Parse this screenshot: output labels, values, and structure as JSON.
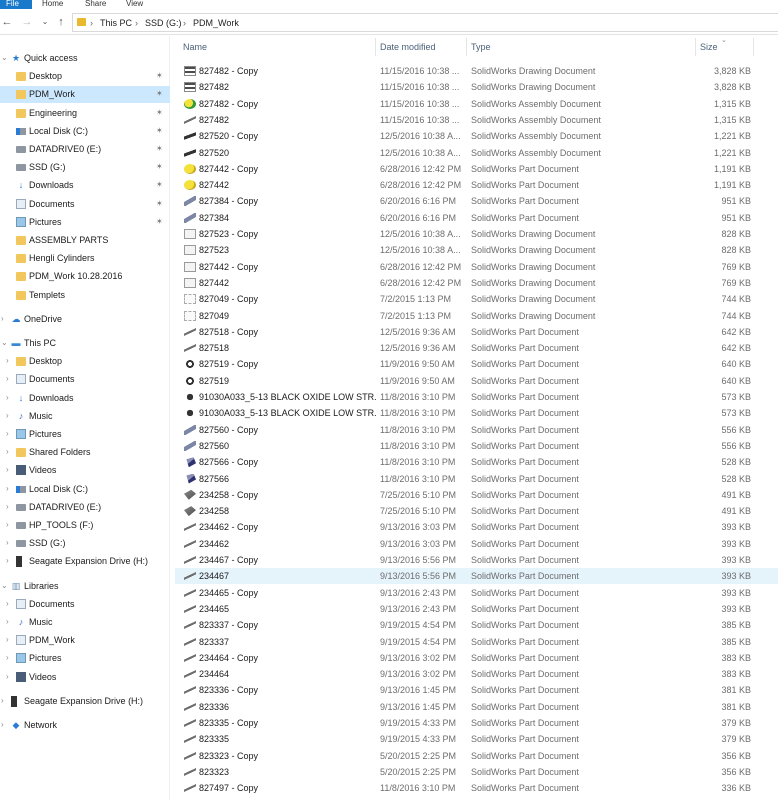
{
  "ribbon": {
    "tabs": [
      "File",
      "Home",
      "Share",
      "View"
    ]
  },
  "address": {
    "crumbs": [
      "This PC",
      "SSD (G:)",
      "PDM_Work"
    ]
  },
  "nav": {
    "items": [
      {
        "label": "Quick access",
        "icon": "star-icon",
        "level": 0,
        "exp": "v",
        "pin": false
      },
      {
        "label": "Desktop",
        "icon": "folder-icon",
        "level": 1,
        "pin": true
      },
      {
        "label": "PDM_Work",
        "icon": "folder-icon",
        "level": 1,
        "pin": true,
        "selected": true
      },
      {
        "label": "Engineering",
        "icon": "folder-icon",
        "level": 1,
        "pin": true
      },
      {
        "label": "Local Disk (C:)",
        "icon": "windows-drive-icon",
        "level": 1,
        "pin": true
      },
      {
        "label": "DATADRIVE0 (E:)",
        "icon": "drive-icon",
        "level": 1,
        "pin": true
      },
      {
        "label": "SSD (G:)",
        "icon": "drive-icon",
        "level": 1,
        "pin": true
      },
      {
        "label": "Downloads",
        "icon": "download-icon",
        "level": 1,
        "pin": true
      },
      {
        "label": "Documents",
        "icon": "document-icon",
        "level": 1,
        "pin": true
      },
      {
        "label": "Pictures",
        "icon": "picture-icon",
        "level": 1,
        "pin": true
      },
      {
        "label": "ASSEMBLY PARTS",
        "icon": "folder-icon",
        "level": 1,
        "pin": false
      },
      {
        "label": "Hengli Cylinders",
        "icon": "folder-icon",
        "level": 1,
        "pin": false
      },
      {
        "label": "PDM_Work 10.28.2016",
        "icon": "folder-icon",
        "level": 1,
        "pin": false
      },
      {
        "label": "Templets",
        "icon": "folder-icon",
        "level": 1,
        "pin": false
      },
      {
        "label": "OneDrive",
        "icon": "cloud-icon",
        "level": 0,
        "exp": ">",
        "gap": true
      },
      {
        "label": "This PC",
        "icon": "computer-icon",
        "level": 0,
        "exp": "v",
        "gap": true
      },
      {
        "label": "Desktop",
        "icon": "folder-icon",
        "level": 1,
        "exp": ">"
      },
      {
        "label": "Documents",
        "icon": "document-icon",
        "level": 1,
        "exp": ">"
      },
      {
        "label": "Downloads",
        "icon": "download-icon",
        "level": 1,
        "exp": ">"
      },
      {
        "label": "Music",
        "icon": "music-icon",
        "level": 1,
        "exp": ">"
      },
      {
        "label": "Pictures",
        "icon": "picture-icon",
        "level": 1,
        "exp": ">"
      },
      {
        "label": "Shared Folders",
        "icon": "folder-icon",
        "level": 1,
        "exp": ">"
      },
      {
        "label": "Videos",
        "icon": "video-icon",
        "level": 1,
        "exp": ">"
      },
      {
        "label": "Local Disk (C:)",
        "icon": "windows-drive-icon",
        "level": 1,
        "exp": ">"
      },
      {
        "label": "DATADRIVE0 (E:)",
        "icon": "drive-icon",
        "level": 1,
        "exp": ">"
      },
      {
        "label": "HP_TOOLS (F:)",
        "icon": "drive-icon",
        "level": 1,
        "exp": ">"
      },
      {
        "label": "SSD (G:)",
        "icon": "drive-icon",
        "level": 1,
        "exp": ">"
      },
      {
        "label": "Seagate Expansion Drive (H:)",
        "icon": "external-drive-icon",
        "level": 1,
        "exp": ">"
      },
      {
        "label": "Libraries",
        "icon": "library-icon",
        "level": 0,
        "exp": "v",
        "gap": true
      },
      {
        "label": "Documents",
        "icon": "document-icon",
        "level": 1,
        "exp": ">"
      },
      {
        "label": "Music",
        "icon": "music-icon",
        "level": 1,
        "exp": ">"
      },
      {
        "label": "PDM_Work",
        "icon": "document-icon",
        "level": 1,
        "exp": ">"
      },
      {
        "label": "Pictures",
        "icon": "picture-icon",
        "level": 1,
        "exp": ">"
      },
      {
        "label": "Videos",
        "icon": "video-icon",
        "level": 1,
        "exp": ">"
      },
      {
        "label": "Seagate Expansion Drive (H:)",
        "icon": "external-drive-icon",
        "level": 0,
        "exp": ">",
        "gap": true
      },
      {
        "label": "Network",
        "icon": "network-icon",
        "level": 0,
        "exp": ">",
        "gap": true
      }
    ]
  },
  "columns": {
    "name": "Name",
    "date": "Date modified",
    "type": "Type",
    "size": "Size"
  },
  "files": [
    {
      "name": "827482 - Copy",
      "date": "11/15/2016 10:38 ...",
      "type": "SolidWorks Drawing Document",
      "size": "3,828 KB",
      "icon": "drw"
    },
    {
      "name": "827482",
      "date": "11/15/2016 10:38 ...",
      "type": "SolidWorks Drawing Document",
      "size": "3,828 KB",
      "icon": "drw"
    },
    {
      "name": "827482 - Copy",
      "date": "11/15/2016 10:38 ...",
      "type": "SolidWorks Assembly Document",
      "size": "1,315 KB",
      "icon": "asm"
    },
    {
      "name": "827482",
      "date": "11/15/2016 10:38 ...",
      "type": "SolidWorks Assembly Document",
      "size": "1,315 KB",
      "icon": "line"
    },
    {
      "name": "827520 - Copy",
      "date": "12/5/2016 10:38 A...",
      "type": "SolidWorks Assembly Document",
      "size": "1,221 KB",
      "icon": "wave"
    },
    {
      "name": "827520",
      "date": "12/5/2016 10:38 A...",
      "type": "SolidWorks Assembly Document",
      "size": "1,221 KB",
      "icon": "wave"
    },
    {
      "name": "827442 - Copy",
      "date": "6/28/2016 12:42 PM",
      "type": "SolidWorks Part Document",
      "size": "1,191 KB",
      "icon": "asm2"
    },
    {
      "name": "827442",
      "date": "6/28/2016 12:42 PM",
      "type": "SolidWorks Part Document",
      "size": "1,191 KB",
      "icon": "asm2"
    },
    {
      "name": "827384 - Copy",
      "date": "6/20/2016 6:16 PM",
      "type": "SolidWorks Part Document",
      "size": "951 KB",
      "icon": "rod"
    },
    {
      "name": "827384",
      "date": "6/20/2016 6:16 PM",
      "type": "SolidWorks Part Document",
      "size": "951 KB",
      "icon": "rod"
    },
    {
      "name": "827523 - Copy",
      "date": "12/5/2016 10:38 A...",
      "type": "SolidWorks Drawing Document",
      "size": "828 KB",
      "icon": "drw2"
    },
    {
      "name": "827523",
      "date": "12/5/2016 10:38 A...",
      "type": "SolidWorks Drawing Document",
      "size": "828 KB",
      "icon": "drw2"
    },
    {
      "name": "827442 - Copy",
      "date": "6/28/2016 12:42 PM",
      "type": "SolidWorks Drawing Document",
      "size": "769 KB",
      "icon": "drw2"
    },
    {
      "name": "827442",
      "date": "6/28/2016 12:42 PM",
      "type": "SolidWorks Drawing Document",
      "size": "769 KB",
      "icon": "drw2"
    },
    {
      "name": "827049 - Copy",
      "date": "7/2/2015 1:13 PM",
      "type": "SolidWorks Drawing Document",
      "size": "744 KB",
      "icon": "drw3"
    },
    {
      "name": "827049",
      "date": "7/2/2015 1:13 PM",
      "type": "SolidWorks Drawing Document",
      "size": "744 KB",
      "icon": "drw3"
    },
    {
      "name": "827518 - Copy",
      "date": "12/5/2016 9:36 AM",
      "type": "SolidWorks Part Document",
      "size": "642 KB",
      "icon": "line"
    },
    {
      "name": "827518",
      "date": "12/5/2016 9:36 AM",
      "type": "SolidWorks Part Document",
      "size": "642 KB",
      "icon": "line"
    },
    {
      "name": "827519 - Copy",
      "date": "11/9/2016 9:50 AM",
      "type": "SolidWorks Part Document",
      "size": "640 KB",
      "icon": "clip"
    },
    {
      "name": "827519",
      "date": "11/9/2016 9:50 AM",
      "type": "SolidWorks Part Document",
      "size": "640 KB",
      "icon": "clip"
    },
    {
      "name": "91030A033_5-13 BLACK OXIDE LOW STR...",
      "date": "11/8/2016 3:10 PM",
      "type": "SolidWorks Part Document",
      "size": "573 KB",
      "icon": "bolt"
    },
    {
      "name": "91030A033_5-13 BLACK OXIDE LOW STR...",
      "date": "11/8/2016 3:10 PM",
      "type": "SolidWorks Part Document",
      "size": "573 KB",
      "icon": "bolt"
    },
    {
      "name": "827560 - Copy",
      "date": "11/8/2016 3:10 PM",
      "type": "SolidWorks Part Document",
      "size": "556 KB",
      "icon": "rod"
    },
    {
      "name": "827560",
      "date": "11/8/2016 3:10 PM",
      "type": "SolidWorks Part Document",
      "size": "556 KB",
      "icon": "rod"
    },
    {
      "name": "827566 - Copy",
      "date": "11/8/2016 3:10 PM",
      "type": "SolidWorks Part Document",
      "size": "528 KB",
      "icon": "part"
    },
    {
      "name": "827566",
      "date": "11/8/2016 3:10 PM",
      "type": "SolidWorks Part Document",
      "size": "528 KB",
      "icon": "part"
    },
    {
      "name": "234258 - Copy",
      "date": "7/25/2016 5:10 PM",
      "type": "SolidWorks Part Document",
      "size": "491 KB",
      "icon": "block"
    },
    {
      "name": "234258",
      "date": "7/25/2016 5:10 PM",
      "type": "SolidWorks Part Document",
      "size": "491 KB",
      "icon": "block"
    },
    {
      "name": "234462 - Copy",
      "date": "9/13/2016 3:03 PM",
      "type": "SolidWorks Part Document",
      "size": "393 KB",
      "icon": "line"
    },
    {
      "name": "234462",
      "date": "9/13/2016 3:03 PM",
      "type": "SolidWorks Part Document",
      "size": "393 KB",
      "icon": "line"
    },
    {
      "name": "234467 - Copy",
      "date": "9/13/2016 5:56 PM",
      "type": "SolidWorks Part Document",
      "size": "393 KB",
      "icon": "line"
    },
    {
      "name": "234467",
      "date": "9/13/2016 5:56 PM",
      "type": "SolidWorks Part Document",
      "size": "393 KB",
      "icon": "line",
      "selected": true
    },
    {
      "name": "234465 - Copy",
      "date": "9/13/2016 2:43 PM",
      "type": "SolidWorks Part Document",
      "size": "393 KB",
      "icon": "line"
    },
    {
      "name": "234465",
      "date": "9/13/2016 2:43 PM",
      "type": "SolidWorks Part Document",
      "size": "393 KB",
      "icon": "line"
    },
    {
      "name": "823337 - Copy",
      "date": "9/19/2015 4:54 PM",
      "type": "SolidWorks Part Document",
      "size": "385 KB",
      "icon": "line"
    },
    {
      "name": "823337",
      "date": "9/19/2015 4:54 PM",
      "type": "SolidWorks Part Document",
      "size": "385 KB",
      "icon": "line"
    },
    {
      "name": "234464 - Copy",
      "date": "9/13/2016 3:02 PM",
      "type": "SolidWorks Part Document",
      "size": "383 KB",
      "icon": "line"
    },
    {
      "name": "234464",
      "date": "9/13/2016 3:02 PM",
      "type": "SolidWorks Part Document",
      "size": "383 KB",
      "icon": "line"
    },
    {
      "name": "823336 - Copy",
      "date": "9/13/2016 1:45 PM",
      "type": "SolidWorks Part Document",
      "size": "381 KB",
      "icon": "line"
    },
    {
      "name": "823336",
      "date": "9/13/2016 1:45 PM",
      "type": "SolidWorks Part Document",
      "size": "381 KB",
      "icon": "line"
    },
    {
      "name": "823335 - Copy",
      "date": "9/19/2015 4:33 PM",
      "type": "SolidWorks Part Document",
      "size": "379 KB",
      "icon": "line"
    },
    {
      "name": "823335",
      "date": "9/19/2015 4:33 PM",
      "type": "SolidWorks Part Document",
      "size": "379 KB",
      "icon": "line"
    },
    {
      "name": "823323 - Copy",
      "date": "5/20/2015 2:25 PM",
      "type": "SolidWorks Part Document",
      "size": "356 KB",
      "icon": "line"
    },
    {
      "name": "823323",
      "date": "5/20/2015 2:25 PM",
      "type": "SolidWorks Part Document",
      "size": "356 KB",
      "icon": "line"
    },
    {
      "name": "827497 - Copy",
      "date": "11/8/2016 3:10 PM",
      "type": "SolidWorks Part Document",
      "size": "336 KB",
      "icon": "line"
    }
  ]
}
